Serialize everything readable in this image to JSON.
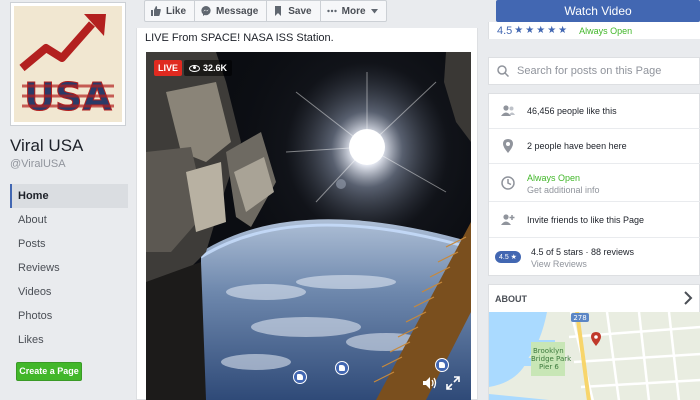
{
  "page": {
    "name": "Viral USA",
    "handle": "@ViralUSA",
    "logo_text": "USA"
  },
  "nav": {
    "items": [
      {
        "label": "Home",
        "active": true
      },
      {
        "label": "About"
      },
      {
        "label": "Posts"
      },
      {
        "label": "Reviews"
      },
      {
        "label": "Videos"
      },
      {
        "label": "Photos"
      },
      {
        "label": "Likes"
      }
    ],
    "create_page": "Create a Page"
  },
  "actions": {
    "like": "Like",
    "message": "Message",
    "save": "Save",
    "more": "More"
  },
  "post": {
    "text": "LIVE From SPACE! NASA ISS Station.",
    "live_badge": "LIVE",
    "viewers": "32.6K"
  },
  "sidebar": {
    "watch_video": "Watch Video",
    "rating_value": "4.5",
    "always_open": "Always Open",
    "search_placeholder": "Search for posts on this Page",
    "info": {
      "likes": "46,456 people like this",
      "been_here": "2 people have been here",
      "hours_status": "Always Open",
      "hours_sub": "Get additional info",
      "invite": "Invite friends to like this Page",
      "rating_pill": "4.5",
      "rating_text": "4.5 of 5 stars · 88 reviews",
      "view_reviews": "View Reviews"
    },
    "about": {
      "heading": "ABOUT",
      "map_route": "278",
      "map_park": "Brooklyn Bridge Park Pier 6"
    }
  },
  "colors": {
    "brand": "#4267b2",
    "live": "#e02a20",
    "open": "#42b72a",
    "create": "#42b72a"
  }
}
